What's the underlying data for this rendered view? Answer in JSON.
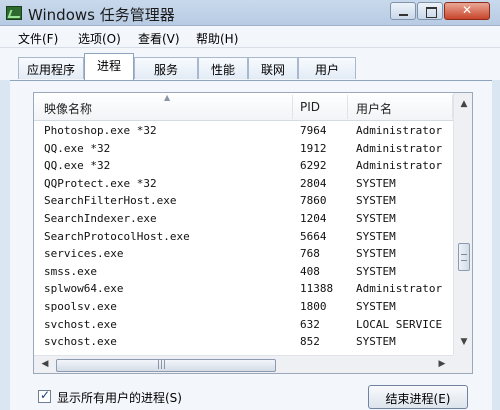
{
  "window": {
    "title": "Windows 任务管理器"
  },
  "menu": [
    "文件(F)",
    "选项(O)",
    "查看(V)",
    "帮助(H)"
  ],
  "tabs": [
    "应用程序",
    "进程",
    "服务",
    "性能",
    "联网",
    "用户"
  ],
  "active_tab": "进程",
  "columns": {
    "name": "映像名称",
    "pid": "PID",
    "user": "用户名"
  },
  "processes": [
    {
      "name": "Photoshop.exe *32",
      "pid": "7964",
      "user": "Administrator"
    },
    {
      "name": "QQ.exe *32",
      "pid": "1912",
      "user": "Administrator"
    },
    {
      "name": "QQ.exe *32",
      "pid": "6292",
      "user": "Administrator"
    },
    {
      "name": "QQProtect.exe *32",
      "pid": "2804",
      "user": "SYSTEM"
    },
    {
      "name": "SearchFilterHost.exe",
      "pid": "7860",
      "user": "SYSTEM"
    },
    {
      "name": "SearchIndexer.exe",
      "pid": "1204",
      "user": "SYSTEM"
    },
    {
      "name": "SearchProtocolHost.exe",
      "pid": "5664",
      "user": "SYSTEM"
    },
    {
      "name": "services.exe",
      "pid": "768",
      "user": "SYSTEM"
    },
    {
      "name": "smss.exe",
      "pid": "408",
      "user": "SYSTEM"
    },
    {
      "name": "splwow64.exe",
      "pid": "11388",
      "user": "Administrator"
    },
    {
      "name": "spoolsv.exe",
      "pid": "1800",
      "user": "SYSTEM"
    },
    {
      "name": "svchost.exe",
      "pid": "632",
      "user": "LOCAL SERVICE"
    },
    {
      "name": "svchost.exe",
      "pid": "852",
      "user": "SYSTEM"
    }
  ],
  "footer": {
    "show_all_users_label": "显示所有用户的进程(S)",
    "show_all_users_checked": true,
    "end_process_label": "结束进程(E)"
  },
  "icons": {
    "app": "task-manager-icon",
    "minimize": "minimize-icon",
    "maximize": "maximize-icon",
    "close": "close-icon",
    "sort": "sort-ascending-icon",
    "scroll_up": "scroll-up-icon",
    "scroll_down": "scroll-down-icon",
    "scroll_left": "scroll-left-icon",
    "scroll_right": "scroll-right-icon"
  }
}
